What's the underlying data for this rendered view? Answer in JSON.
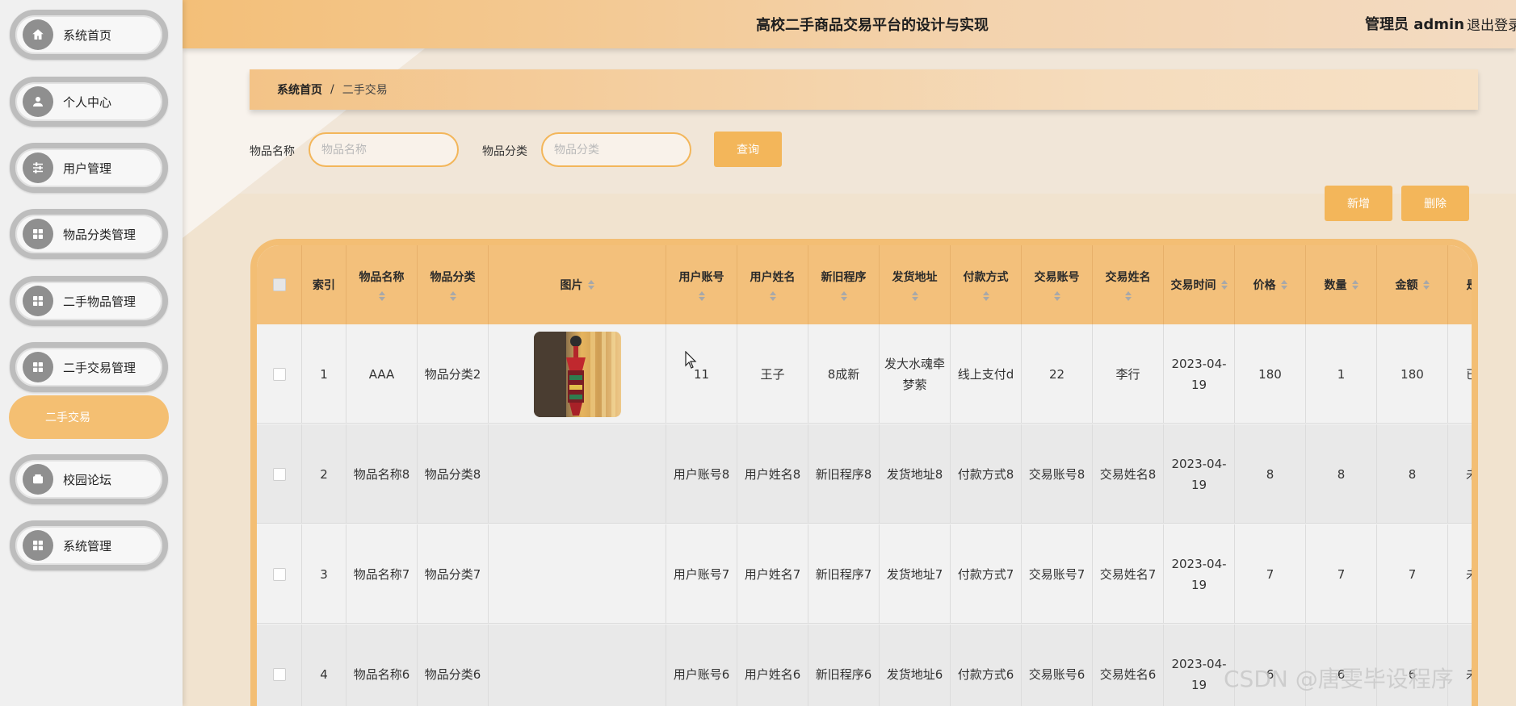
{
  "app": {
    "title": "高校二手商品交易平台的设计与实现",
    "admin_label": "管理员 admin",
    "logout_label": "退出登录"
  },
  "sidebar": {
    "items": [
      {
        "label": "系统首页",
        "icon": "home-icon"
      },
      {
        "label": "个人中心",
        "icon": "user-icon"
      },
      {
        "label": "用户管理",
        "icon": "sliders-icon"
      },
      {
        "label": "物品分类管理",
        "icon": "grid-icon"
      },
      {
        "label": "二手物品管理",
        "icon": "grid-icon"
      },
      {
        "label": "二手交易管理",
        "icon": "grid-icon"
      },
      {
        "label": "校园论坛",
        "icon": "wallet-icon"
      },
      {
        "label": "系统管理",
        "icon": "grid-icon"
      }
    ],
    "active_sub": "二手交易"
  },
  "breadcrumb": {
    "home": "系统首页",
    "separator": "/",
    "current": "二手交易"
  },
  "search": {
    "name_label": "物品名称",
    "name_placeholder": "物品名称",
    "category_label": "物品分类",
    "category_placeholder": "物品分类",
    "query_button": "查询"
  },
  "actions": {
    "add_button": "新增",
    "delete_button": "删除"
  },
  "table": {
    "columns": [
      "",
      "索引",
      "物品名称",
      "物品分类",
      "图片",
      "用户账号",
      "用户姓名",
      "新旧程序",
      "发货地址",
      "付款方式",
      "交易账号",
      "交易姓名",
      "交易时间",
      "价格",
      "数量",
      "金额",
      "是"
    ],
    "rows": [
      [
        "",
        "1",
        "AAA",
        "物品分类2",
        "",
        "11",
        "王子",
        "8成新",
        "发大水魂牵梦萦",
        "线上支付d",
        "22",
        "李行",
        "2023-04-19",
        "180",
        "1",
        "180",
        "已"
      ],
      [
        "",
        "2",
        "物品名称8",
        "物品分类8",
        "",
        "用户账号8",
        "用户姓名8",
        "新旧程序8",
        "发货地址8",
        "付款方式8",
        "交易账号8",
        "交易姓名8",
        "2023-04-19",
        "8",
        "8",
        "8",
        "未"
      ],
      [
        "",
        "3",
        "物品名称7",
        "物品分类7",
        "",
        "用户账号7",
        "用户姓名7",
        "新旧程序7",
        "发货地址7",
        "付款方式7",
        "交易账号7",
        "交易姓名7",
        "2023-04-19",
        "7",
        "7",
        "7",
        "未"
      ],
      [
        "",
        "4",
        "物品名称6",
        "物品分类6",
        "",
        "用户账号6",
        "用户姓名6",
        "新旧程序6",
        "发货地址6",
        "付款方式6",
        "交易账号6",
        "交易姓名6",
        "2023-04-19",
        "6",
        "6",
        "6",
        "未"
      ]
    ]
  },
  "watermark": "CSDN @唐雯毕设程序",
  "colors": {
    "accent": "#f3b65a",
    "header_start": "#f3bf78",
    "table_header": "#f3c07b"
  }
}
